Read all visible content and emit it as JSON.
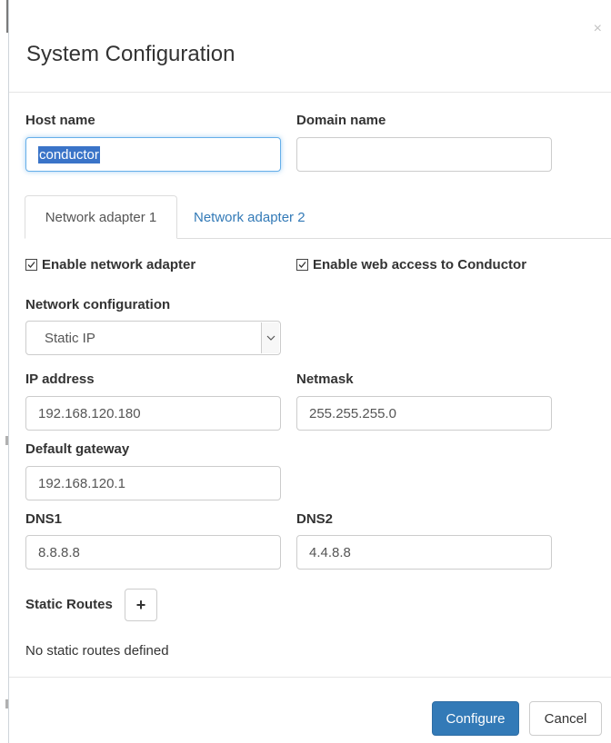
{
  "modal": {
    "title": "System Configuration",
    "close_symbol": "×"
  },
  "host": {
    "label": "Host name",
    "value": "conductor"
  },
  "domain": {
    "label": "Domain name",
    "value": ""
  },
  "tabs": [
    {
      "label": "Network adapter 1",
      "active": true
    },
    {
      "label": "Network adapter 2",
      "active": false
    }
  ],
  "checkboxes": {
    "enable_adapter": {
      "label": "Enable network adapter",
      "checked": true
    },
    "enable_web_access": {
      "label": "Enable web access to Conductor",
      "checked": true
    }
  },
  "network_config": {
    "label": "Network configuration",
    "selected": "Static IP"
  },
  "ip": {
    "label": "IP address",
    "value": "192.168.120.180"
  },
  "netmask": {
    "label": "Netmask",
    "value": "255.255.255.0"
  },
  "gateway": {
    "label": "Default gateway",
    "value": "192.168.120.1"
  },
  "dns1": {
    "label": "DNS1",
    "value": "8.8.8.8"
  },
  "dns2": {
    "label": "DNS2",
    "value": "4.4.8.8"
  },
  "static_routes": {
    "label": "Static Routes",
    "add_symbol": "+",
    "empty_message": "No static routes defined"
  },
  "footer": {
    "configure_label": "Configure",
    "cancel_label": "Cancel"
  },
  "colors": {
    "primary": "#337ab7",
    "link": "#337ab7",
    "focus": "#66afe9",
    "selection": "#3a74c8"
  },
  "icons": {
    "close": "close-icon",
    "checkbox": "checkmark-icon",
    "select": "chevron-down-icon",
    "add": "plus-icon"
  }
}
